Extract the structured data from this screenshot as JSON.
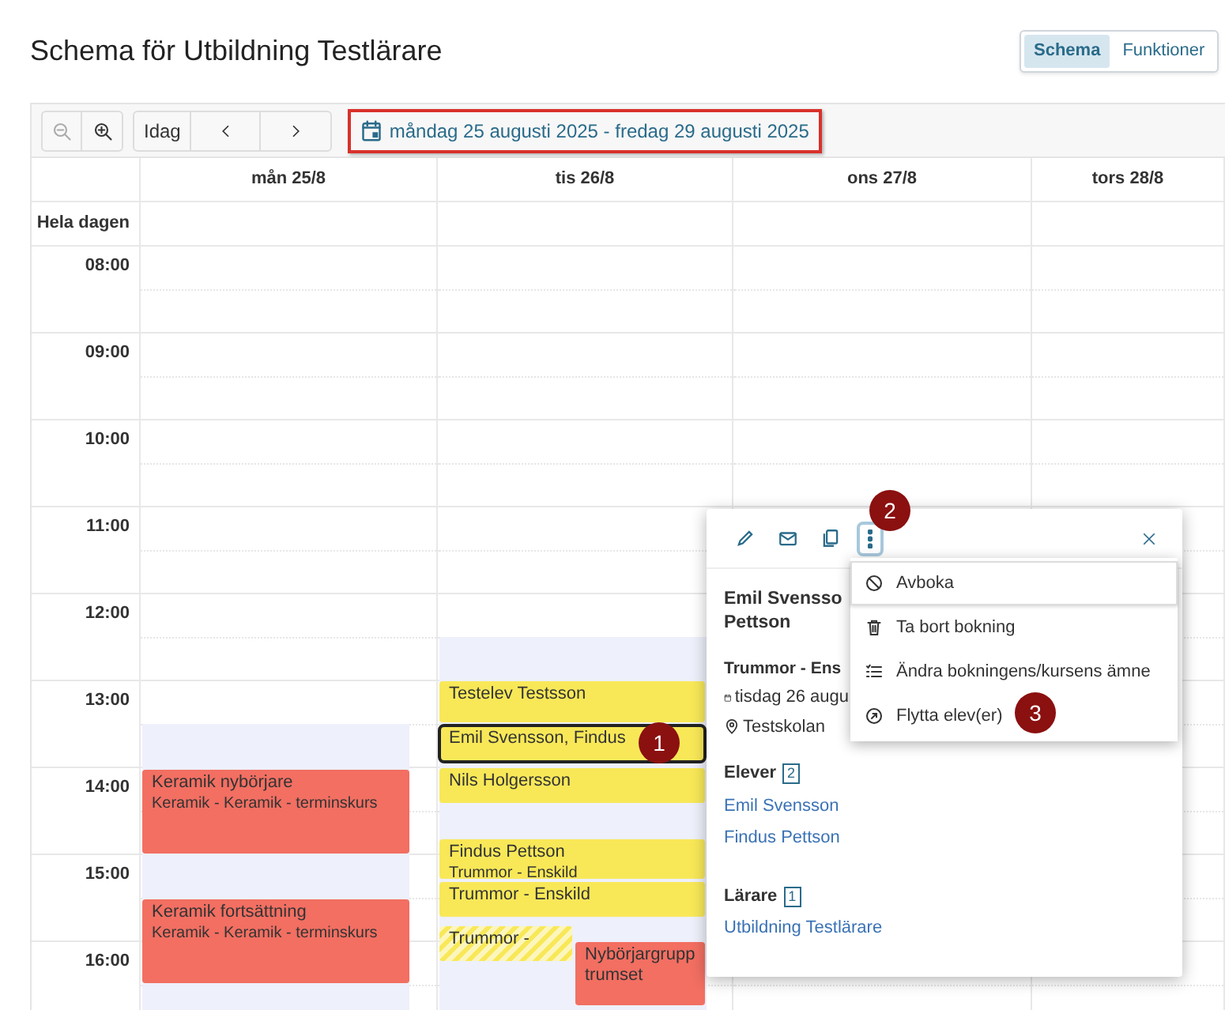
{
  "title": "Schema för Utbildning Testlärare",
  "view_tabs": [
    {
      "label": "Schema",
      "selected": true
    },
    {
      "label": "Funktioner",
      "selected": false
    }
  ],
  "toolbar": {
    "zoom_out_disabled": true,
    "zoom_in_disabled": false,
    "today": "Idag",
    "date_range": "måndag 25 augusti 2025 - fredag 29 augusti 2025",
    "date_range_highlighted": true
  },
  "calendar": {
    "all_day_label": "Hela dagen",
    "hours": [
      "08:00",
      "09:00",
      "10:00",
      "11:00",
      "12:00",
      "13:00",
      "14:00",
      "15:00",
      "16:00"
    ],
    "days": [
      {
        "label": "mån 25/8",
        "events": [
          {
            "title": "Keramik nybörjare",
            "subtitle": "Keramik - Keramik - terminskurs",
            "color": "#f26f62",
            "selected": false,
            "tentative": false
          },
          {
            "title": "Keramik fortsättning",
            "subtitle": "Keramik - Keramik - terminskurs",
            "color": "#f26f62",
            "selected": false,
            "tentative": false
          }
        ]
      },
      {
        "label": "tis 26/8",
        "events": [
          {
            "title": "Testelev Testsson",
            "color": "#f8e858",
            "selected": false,
            "tentative": false
          },
          {
            "title": "Emil Svensson, Findus",
            "color": "#f8e858",
            "selected": true,
            "tentative": false
          },
          {
            "title": "Nils Holgersson",
            "color": "#f8e858",
            "selected": false,
            "tentative": false
          },
          {
            "title": "Findus Pettson",
            "subtitle": "Trummor - Enskild",
            "color": "#f8e858",
            "selected": false,
            "tentative": false
          },
          {
            "title": "Trummor - Enskild",
            "color": "#f8e858",
            "selected": false,
            "tentative": false
          },
          {
            "title": "Trummor -",
            "color": "#f8e858",
            "selected": false,
            "tentative": true
          },
          {
            "title": "Nybörjargrupp trumset",
            "color": "#f26f62",
            "selected": false,
            "tentative": false
          }
        ]
      },
      {
        "label": "ons 27/8"
      },
      {
        "label": "tors 28/8"
      }
    ]
  },
  "popup": {
    "title_lines": [
      "Emil Svensso",
      "Pettson"
    ],
    "course": "Trummor - Ens",
    "date": "tisdag 26 augu",
    "location": "Testskolan",
    "students_label": "Elever",
    "students_count": "2",
    "students": [
      "Emil Svensson",
      "Findus Pettson"
    ],
    "teachers_label": "Lärare",
    "teachers_count": "1",
    "teachers": [
      "Utbildning Testlärare"
    ]
  },
  "menu": [
    {
      "label": "Avboka",
      "selected": true
    },
    {
      "label": "Ta bort bokning",
      "selected": false
    },
    {
      "label": "Ändra bokningens/kursens ämne",
      "selected": false
    },
    {
      "label": "Flytta elev(er)",
      "selected": false
    }
  ],
  "markers": [
    "1",
    "2",
    "3"
  ]
}
